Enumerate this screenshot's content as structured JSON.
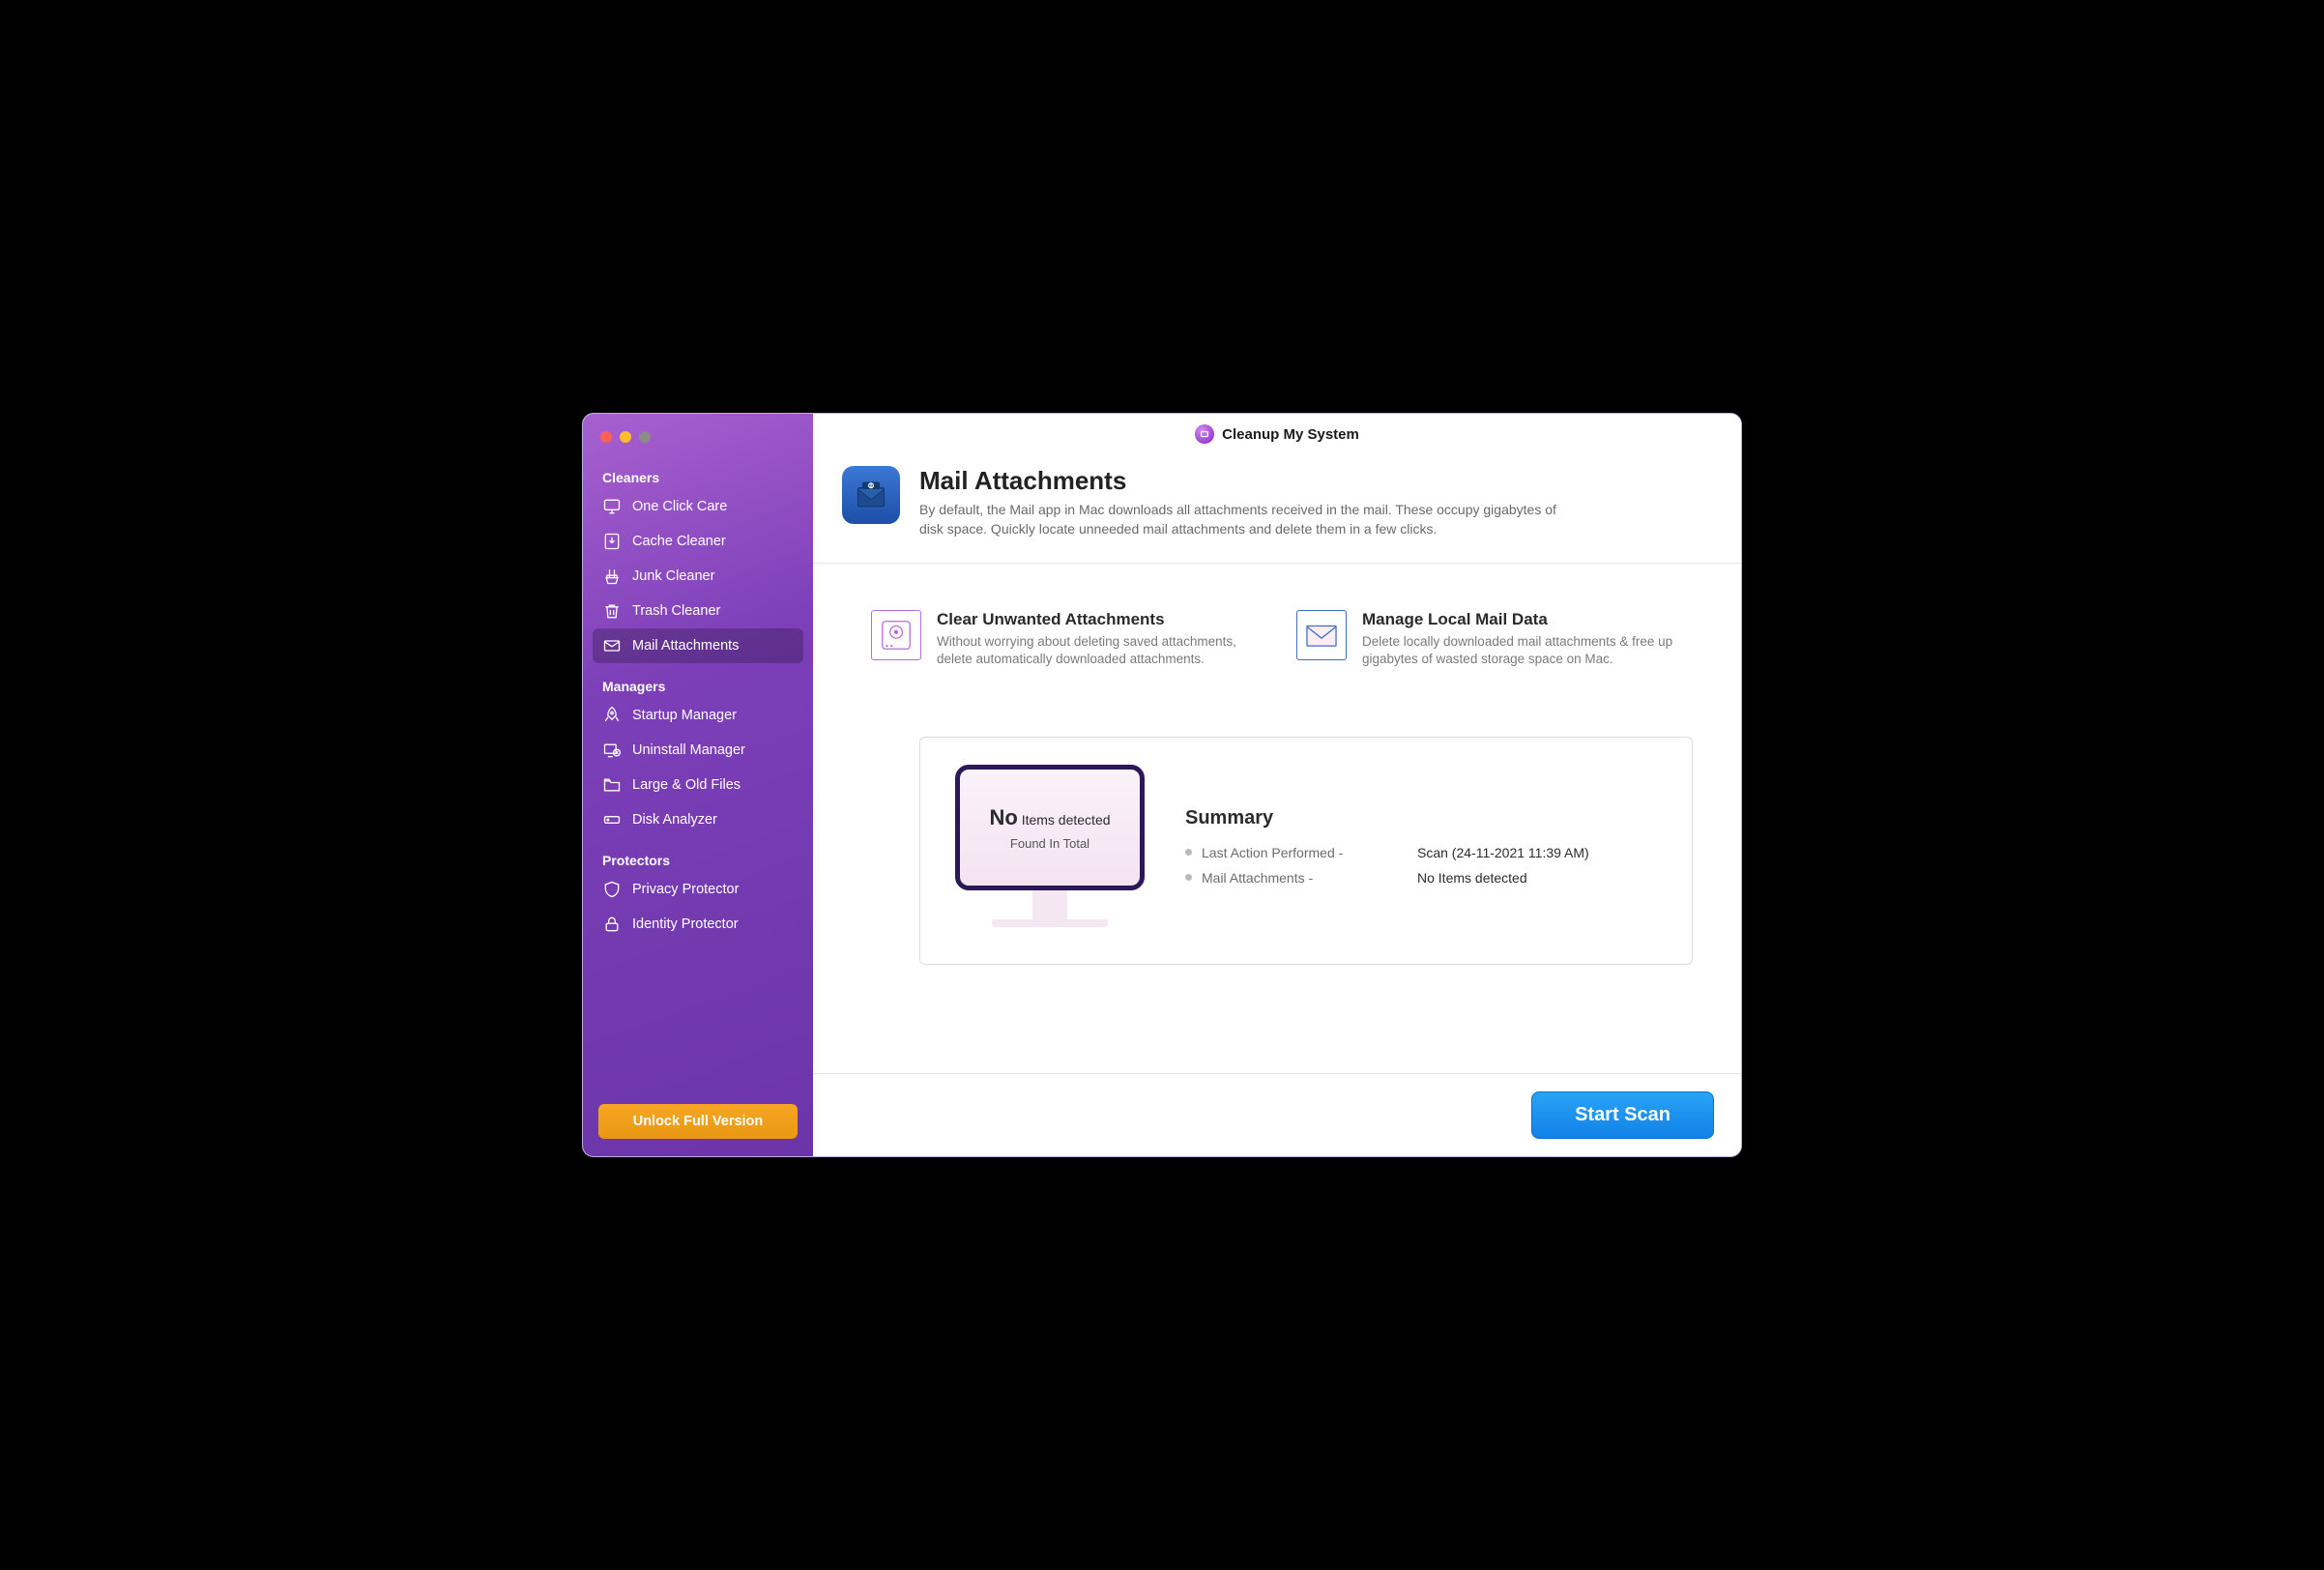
{
  "app_title": "Cleanup My System",
  "sidebar": {
    "sections": [
      {
        "label": "Cleaners",
        "items": [
          {
            "label": "One Click Care",
            "icon": "monitor-icon",
            "slug": "one-click-care"
          },
          {
            "label": "Cache Cleaner",
            "icon": "download-box-icon",
            "slug": "cache-cleaner"
          },
          {
            "label": "Junk Cleaner",
            "icon": "broom-icon",
            "slug": "junk-cleaner"
          },
          {
            "label": "Trash Cleaner",
            "icon": "trash-icon",
            "slug": "trash-cleaner"
          },
          {
            "label": "Mail Attachments",
            "icon": "mail-icon",
            "slug": "mail-attachments",
            "active": true
          }
        ]
      },
      {
        "label": "Managers",
        "items": [
          {
            "label": "Startup Manager",
            "icon": "rocket-icon",
            "slug": "startup-manager"
          },
          {
            "label": "Uninstall Manager",
            "icon": "uninstall-icon",
            "slug": "uninstall-manager"
          },
          {
            "label": "Large & Old Files",
            "icon": "folder-icon",
            "slug": "large-old-files"
          },
          {
            "label": "Disk Analyzer",
            "icon": "disk-icon",
            "slug": "disk-analyzer"
          }
        ]
      },
      {
        "label": "Protectors",
        "items": [
          {
            "label": "Privacy Protector",
            "icon": "shield-icon",
            "slug": "privacy-protector"
          },
          {
            "label": "Identity Protector",
            "icon": "lock-icon",
            "slug": "identity-protector"
          }
        ]
      }
    ],
    "unlock_label": "Unlock Full Version"
  },
  "page": {
    "title": "Mail Attachments",
    "description": "By default, the Mail app in Mac downloads all attachments received in the mail. These occupy gigabytes of disk space. Quickly locate unneeded mail attachments and delete them in a few clicks."
  },
  "features": [
    {
      "title": "Clear Unwanted Attachments",
      "desc": "Without worrying about deleting saved attachments, delete automatically downloaded attachments.",
      "icon": "drive-clear-icon"
    },
    {
      "title": "Manage Local Mail Data",
      "desc": "Delete locally downloaded mail attachments & free up gigabytes of wasted storage space on Mac.",
      "icon": "envelope-icon"
    }
  ],
  "summary": {
    "heading": "Summary",
    "monitor_primary_prefix": "No",
    "monitor_primary_suffix": "Items detected",
    "monitor_secondary": "Found In Total",
    "rows": [
      {
        "label": "Last Action Performed -",
        "value": "Scan (24-11-2021 11:39 AM)"
      },
      {
        "label": "Mail Attachments -",
        "value": "No Items detected"
      }
    ]
  },
  "footer": {
    "start_scan": "Start Scan"
  }
}
